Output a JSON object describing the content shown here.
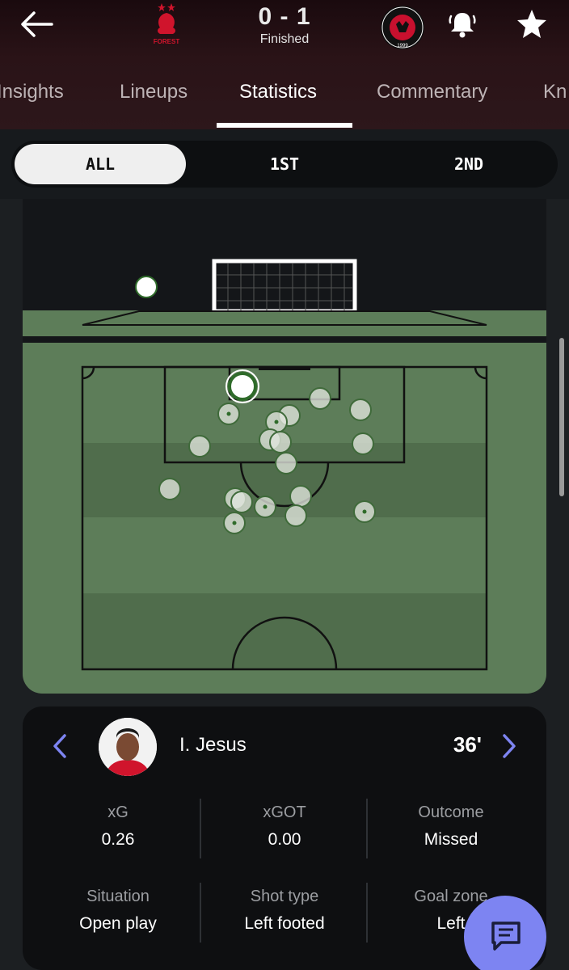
{
  "header": {
    "score": "0 - 1",
    "status": "Finished",
    "home_logo_text": "FOREST",
    "away_logo_text": "FC MIDTJYLLAND 1999"
  },
  "tabs": [
    {
      "label": "Insights"
    },
    {
      "label": "Lineups"
    },
    {
      "label": "Statistics"
    },
    {
      "label": "Commentary"
    },
    {
      "label": "Kn"
    }
  ],
  "active_tab": "Statistics",
  "periods": [
    {
      "label": "ALL"
    },
    {
      "label": "1ST"
    },
    {
      "label": "2ND"
    }
  ],
  "active_period": "ALL",
  "shot_detail": {
    "player": "I. Jesus",
    "minute": "36'",
    "stats": [
      {
        "label": "xG",
        "value": "0.26"
      },
      {
        "label": "xGOT",
        "value": "0.00"
      },
      {
        "label": "Outcome",
        "value": "Missed"
      },
      {
        "label": "Situation",
        "value": "Open play"
      },
      {
        "label": "Shot type",
        "value": "Left footed"
      },
      {
        "label": "Goal zone",
        "value": "Left"
      }
    ]
  },
  "colors": {
    "pitch_light": "#5d7d59",
    "pitch_dark": "#506d4c",
    "accent": "#7d84f2"
  }
}
